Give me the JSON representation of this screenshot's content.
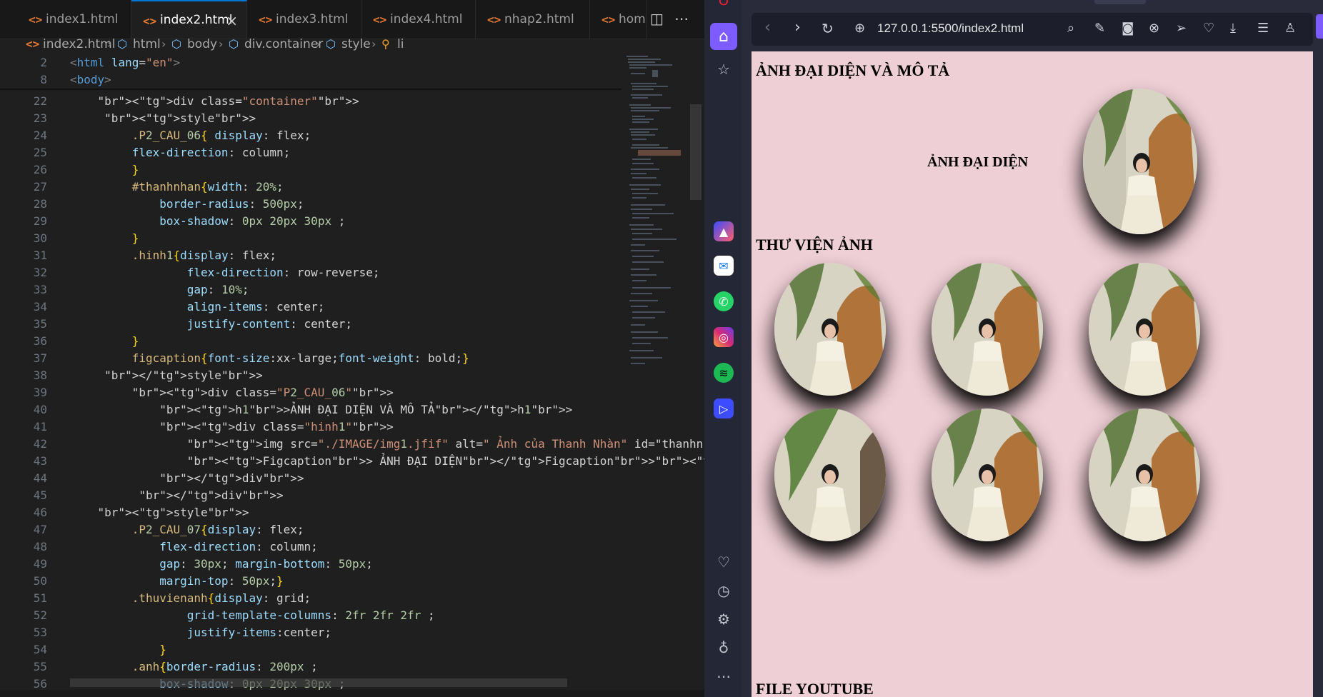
{
  "editor": {
    "tabs": [
      {
        "label": "index1.html",
        "active": false
      },
      {
        "label": "index2.html",
        "active": true
      },
      {
        "label": "index3.html",
        "active": false
      },
      {
        "label": "index4.html",
        "active": false
      },
      {
        "label": "nhap2.html",
        "active": false
      },
      {
        "label": "hom",
        "active": false
      }
    ],
    "breadcrumb": [
      "index2.html",
      "html",
      "body",
      "div.container",
      "style",
      "li"
    ],
    "sticky_lines": [
      {
        "num": "2",
        "text": "<html lang=\"en\">"
      },
      {
        "num": "8",
        "text": "<body>"
      }
    ],
    "lines": [
      {
        "num": "22",
        "text": "    <div class=\"container\">"
      },
      {
        "num": "23",
        "text": "     <style>"
      },
      {
        "num": "24",
        "text": "         .P2_CAU_06{ display: flex;"
      },
      {
        "num": "25",
        "text": "         flex-direction: column;"
      },
      {
        "num": "26",
        "text": "         }"
      },
      {
        "num": "27",
        "text": "         #thanhnhan{width: 20%;"
      },
      {
        "num": "28",
        "text": "             border-radius: 500px;"
      },
      {
        "num": "29",
        "text": "             box-shadow: 0px 20px 30px ;"
      },
      {
        "num": "30",
        "text": "         }"
      },
      {
        "num": "31",
        "text": "         .hinh1{display: flex;"
      },
      {
        "num": "32",
        "text": "                 flex-direction: row-reverse;"
      },
      {
        "num": "33",
        "text": "                 gap: 10%;"
      },
      {
        "num": "34",
        "text": "                 align-items: center;"
      },
      {
        "num": "35",
        "text": "                 justify-content: center;"
      },
      {
        "num": "36",
        "text": "         }"
      },
      {
        "num": "37",
        "text": "         figcaption{font-size:xx-large;font-weight: bold;}"
      },
      {
        "num": "38",
        "text": "     </style>"
      },
      {
        "num": "39",
        "text": "         <div class=\"P2_CAU_06\">"
      },
      {
        "num": "40",
        "text": "             <h1>ẢNH ĐẠI DIỆN VÀ MÔ TẢ</h1>"
      },
      {
        "num": "41",
        "text": "             <div class=\"hinh1\">"
      },
      {
        "num": "42",
        "text": "                 <img src=\"./IMAGE/img1.jfif\" alt=\" Ảnh của Thanh Nhàn\" id=\"thanhn"
      },
      {
        "num": "43",
        "text": "                 <Figcaption> ẢNH ĐẠI DIỆN</Figcaption><br>"
      },
      {
        "num": "44",
        "text": "             </div>"
      },
      {
        "num": "45",
        "text": "          </div>"
      },
      {
        "num": "46",
        "text": "    <style>"
      },
      {
        "num": "47",
        "text": "         .P2_CAU_07{display: flex;"
      },
      {
        "num": "48",
        "text": "             flex-direction: column;"
      },
      {
        "num": "49",
        "text": "             gap: 30px; margin-bottom: 50px;"
      },
      {
        "num": "50",
        "text": "             margin-top: 50px;}"
      },
      {
        "num": "51",
        "text": "         .thuvienanh{display: grid;"
      },
      {
        "num": "52",
        "text": "                 grid-template-columns: 2fr 2fr 2fr ;"
      },
      {
        "num": "53",
        "text": "                 justify-items:center;"
      },
      {
        "num": "54",
        "text": "             }"
      },
      {
        "num": "55",
        "text": "         .anh{border-radius: 200px ;"
      },
      {
        "num": "56",
        "text": "             box-shadow: 0px 20px 30px ;"
      }
    ]
  },
  "browser": {
    "url": "127.0.0.1:5500/index2.html",
    "page": {
      "heading1": "ẢNH ĐẠI DIỆN VÀ MÔ TẢ",
      "caption": "ẢNH ĐẠI DIỆN",
      "heading2": "THƯ VIỆN ẢNH",
      "heading3": "FILE YOUTUBE"
    }
  },
  "colors": {
    "editor_bg": "#1f1f1f",
    "page_bg": "#efcfd6",
    "opera_sidebar": "#242736",
    "accent": "#7c5cff"
  }
}
